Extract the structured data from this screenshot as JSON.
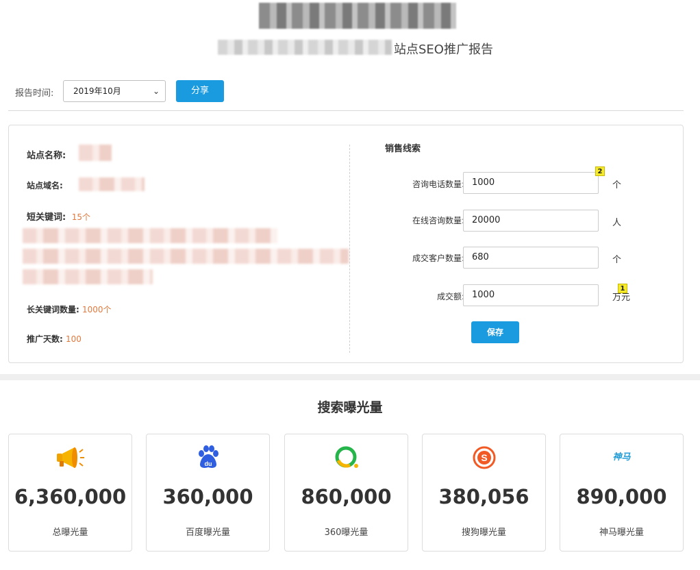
{
  "header": {
    "title_suffix": "站点SEO推广报告"
  },
  "filter": {
    "label": "报告时间:",
    "selected_month": "2019年10月",
    "share_label": "分享"
  },
  "site_info": {
    "name_label": "站点名称:",
    "domain_label": "站点域名:",
    "short_kw_label": "短关键词:",
    "short_kw_count": "15个",
    "long_kw_label": "长关键词数量:",
    "long_kw_count": "1000个",
    "days_label": "推广天数:",
    "days_value": "100"
  },
  "sales_leads": {
    "title": "销售线索",
    "fields": [
      {
        "label": "咨询电话数量:",
        "value": "1000",
        "unit": "个"
      },
      {
        "label": "在线咨询数量:",
        "value": "20000",
        "unit": "人"
      },
      {
        "label": "成交客户数量:",
        "value": "680",
        "unit": "个"
      },
      {
        "label": "成交额:",
        "value": "1000",
        "unit": "万元"
      }
    ],
    "badges": [
      "2",
      "1"
    ],
    "save_label": "保存"
  },
  "exposure": {
    "title": "搜索曝光量",
    "cards": [
      {
        "icon": "megaphone-icon",
        "value": "6,360,000",
        "label": "总曝光量"
      },
      {
        "icon": "baidu-icon",
        "value": "360,000",
        "label": "百度曝光量"
      },
      {
        "icon": "360-search-icon",
        "value": "860,000",
        "label": "360曝光量"
      },
      {
        "icon": "sogou-icon",
        "value": "380,056",
        "label": "搜狗曝光量"
      },
      {
        "icon": "shenma-icon",
        "value": "890,000",
        "label": "神马曝光量",
        "icon_text": "神马"
      }
    ]
  },
  "colors": {
    "primary": "#1a9be0",
    "accent_orange": "#e0793d",
    "baidu_blue": "#2f5fe0",
    "green_360": "#25b54b",
    "yellow_360": "#f6b400",
    "sogou_red": "#f15a24",
    "shenma_blue": "#1f9bd7"
  }
}
